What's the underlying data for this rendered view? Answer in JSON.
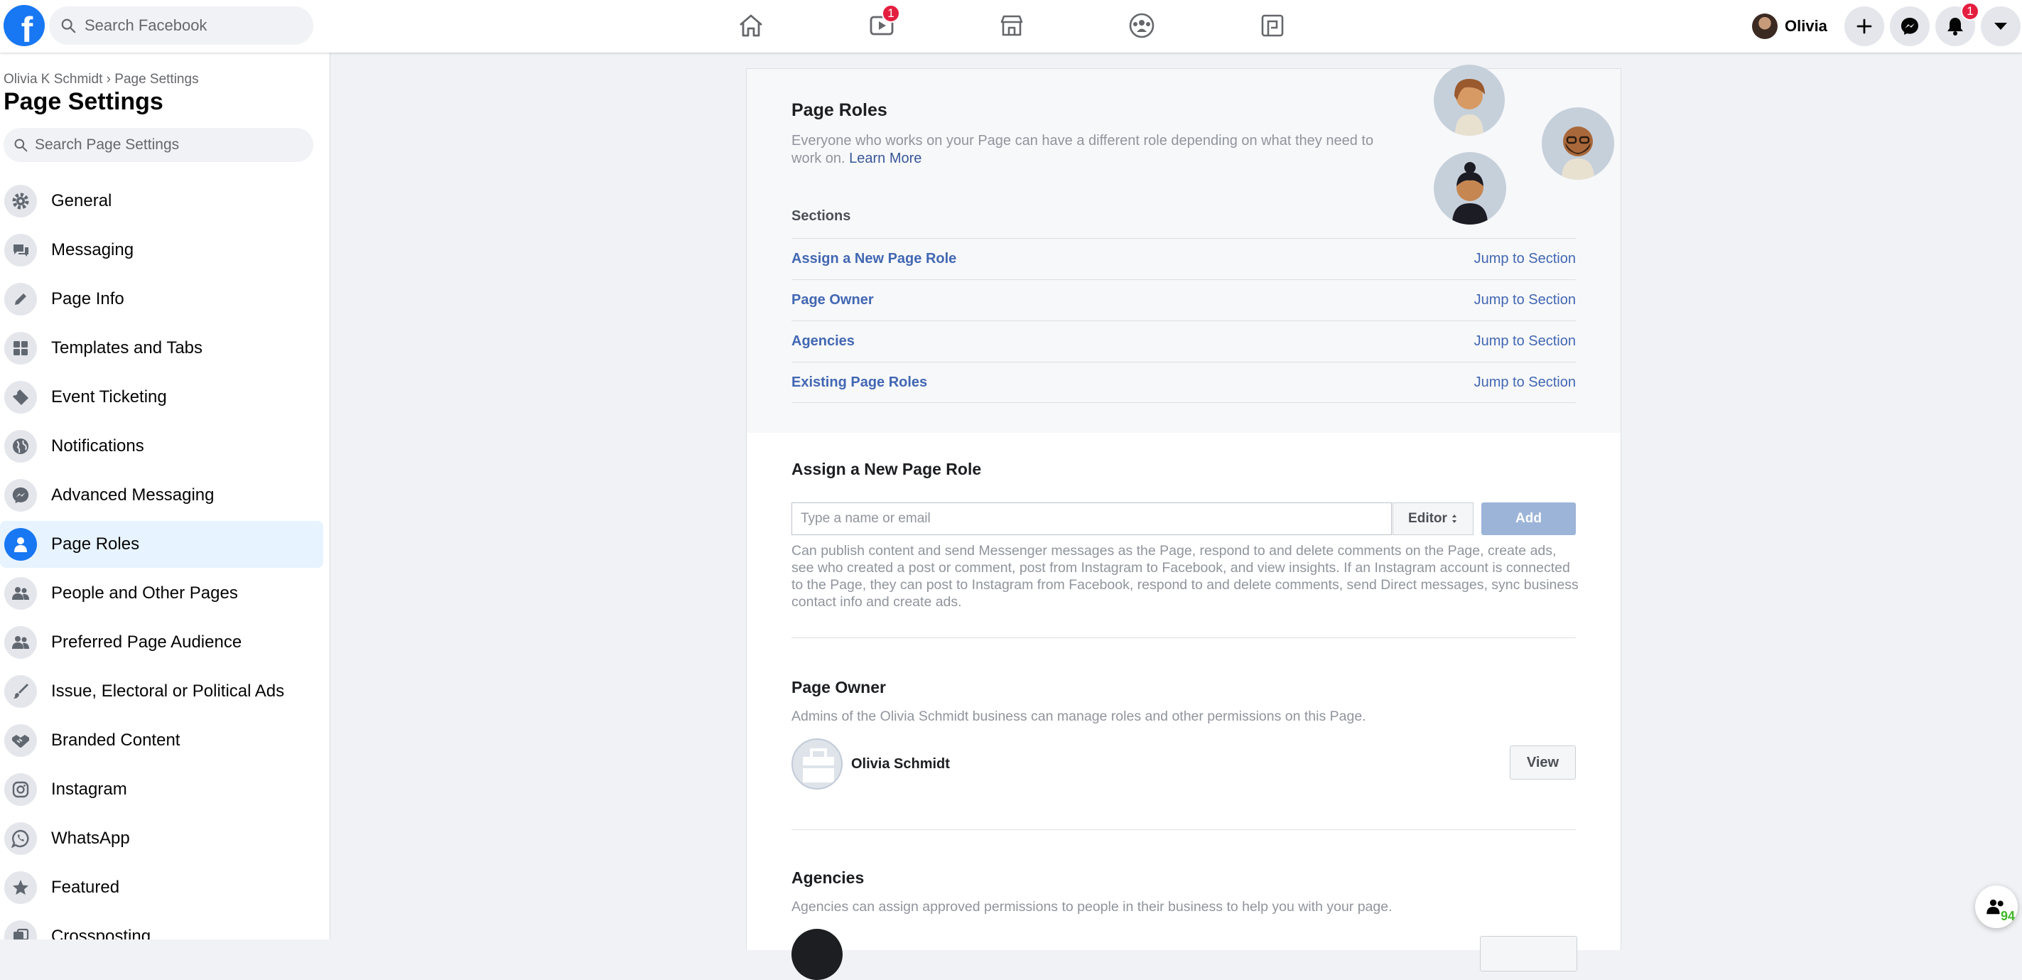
{
  "topbar": {
    "logo": "f",
    "search_placeholder": "Search Facebook",
    "nav": [
      {
        "name": "home",
        "icon": "home-icon",
        "badge": null
      },
      {
        "name": "watch",
        "icon": "video-icon",
        "badge": "1"
      },
      {
        "name": "marketplace",
        "icon": "marketplace-icon",
        "badge": null
      },
      {
        "name": "groups",
        "icon": "groups-icon",
        "badge": null
      },
      {
        "name": "gaming",
        "icon": "gaming-icon",
        "badge": null
      }
    ],
    "profile_name": "Olivia",
    "notification_badge": "1"
  },
  "sidebar": {
    "breadcrumb_parent": "Olivia K Schmidt",
    "breadcrumb_sep": "›",
    "breadcrumb_current": "Page Settings",
    "title": "Page Settings",
    "search_placeholder": "Search Page Settings",
    "items": [
      {
        "label": "General",
        "icon": "gear-icon"
      },
      {
        "label": "Messaging",
        "icon": "chat-icon"
      },
      {
        "label": "Page Info",
        "icon": "pencil-icon"
      },
      {
        "label": "Templates and Tabs",
        "icon": "grid-icon"
      },
      {
        "label": "Event Ticketing",
        "icon": "ticket-icon"
      },
      {
        "label": "Notifications",
        "icon": "globe-icon"
      },
      {
        "label": "Advanced Messaging",
        "icon": "messenger-icon"
      },
      {
        "label": "Page Roles",
        "icon": "person-icon",
        "active": true
      },
      {
        "label": "People and Other Pages",
        "icon": "people-icon"
      },
      {
        "label": "Preferred Page Audience",
        "icon": "people-icon"
      },
      {
        "label": "Issue, Electoral or Political Ads",
        "icon": "brush-icon"
      },
      {
        "label": "Branded Content",
        "icon": "handshake-icon"
      },
      {
        "label": "Instagram",
        "icon": "instagram-icon"
      },
      {
        "label": "WhatsApp",
        "icon": "whatsapp-icon"
      },
      {
        "label": "Featured",
        "icon": "star-icon"
      },
      {
        "label": "Crossposting",
        "icon": "crosspost-icon"
      }
    ]
  },
  "main": {
    "header": {
      "title": "Page Roles",
      "desc": "Everyone who works on your Page can have a different role depending on what they need to work on.",
      "learn_more": "Learn More",
      "sections_label": "Sections",
      "jump_label": "Jump to Section",
      "sections": [
        "Assign a New Page Role",
        "Page Owner",
        "Agencies",
        "Existing Page Roles"
      ]
    },
    "assign": {
      "title": "Assign a New Page Role",
      "input_placeholder": "Type a name or email",
      "role_selected": "Editor",
      "add_label": "Add",
      "role_desc": "Can publish content and send Messenger messages as the Page, respond to and delete comments on the Page, create ads, see who created a post or comment, post from Instagram to Facebook, and view insights. If an Instagram account is connected to the Page, they can post to Instagram from Facebook, respond to and delete comments, send Direct messages, sync business contact info and create ads."
    },
    "owner": {
      "title": "Page Owner",
      "desc": "Admins of the Olivia Schmidt business can manage roles and other permissions on this Page.",
      "name": "Olivia Schmidt",
      "view_label": "View"
    },
    "agencies": {
      "title": "Agencies",
      "desc": "Agencies can assign approved permissions to people in their business to help you with your page."
    }
  },
  "floating_chat": {
    "count": "94"
  },
  "colors": {
    "brand": "#1877f2",
    "link": "#4267b2",
    "badge": "#e41e3f"
  }
}
